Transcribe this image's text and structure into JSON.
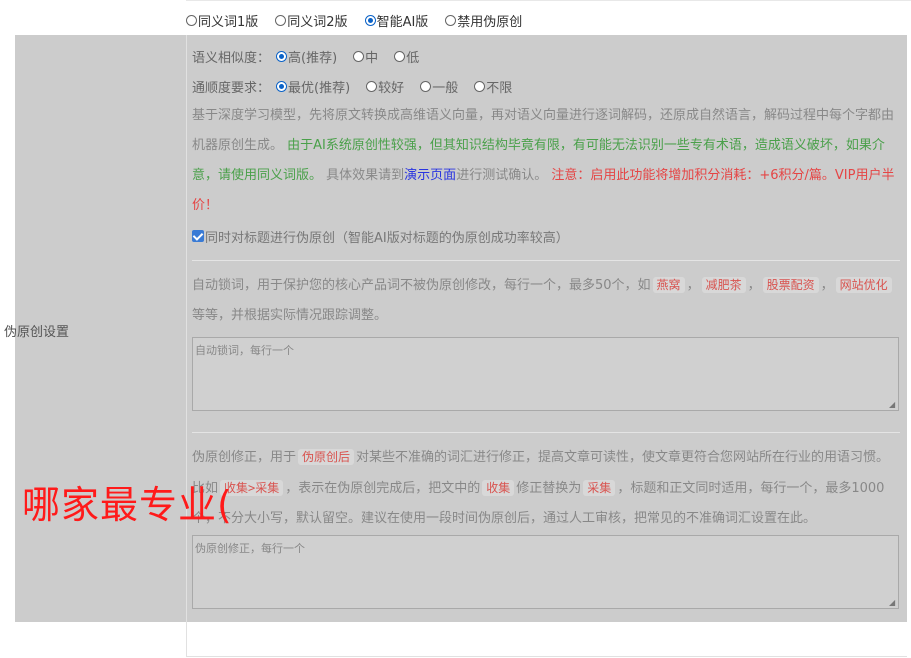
{
  "version_options": [
    {
      "label": "同义词1版",
      "checked": false
    },
    {
      "label": "同义词2版",
      "checked": false
    },
    {
      "label": "智能AI版",
      "checked": true
    },
    {
      "label": "禁用伪原创",
      "checked": false
    }
  ],
  "section_label": "伪原创设置",
  "similarity": {
    "label": "语义相似度：",
    "options": [
      {
        "label": "高(推荐)",
        "checked": true
      },
      {
        "label": "中",
        "checked": false
      },
      {
        "label": "低",
        "checked": false
      }
    ]
  },
  "fluency": {
    "label": "通顺度要求：",
    "options": [
      {
        "label": "最优(推荐)",
        "checked": true
      },
      {
        "label": "较好",
        "checked": false
      },
      {
        "label": "一般",
        "checked": false
      },
      {
        "label": "不限",
        "checked": false
      }
    ]
  },
  "description": {
    "intro": "基于深度学习模型，先将原文转换成高维语义向量，再对语义向量进行逐词解码，还原成自然语言，解码过程中每个字都由机器原创生成。",
    "green_note": "由于AI系统原创性较强，但其知识结构毕竟有限，有可能无法识别一些专有术语，造成语义破坏，如果介意，请使用同义词版。",
    "effect_prefix": "具体效果请到",
    "demo_link": "演示页面",
    "effect_suffix": "进行测试确认。",
    "red_note": "注意：启用此功能将增加积分消耗：+6积分/篇。VIP用户半价！"
  },
  "title_checkbox": {
    "label": "同时对标题进行伪原创（智能AI版对标题的伪原创成功率较高）",
    "checked": true
  },
  "lock_words": {
    "desc_prefix": "自动锁词，用于保护您的核心产品词不被伪原创修改，每行一个，最多50个，如",
    "examples": [
      "燕窝",
      "减肥茶",
      "股票配资",
      "网站优化"
    ],
    "desc_suffix": "等等，并根据实际情况跟踪调整。",
    "placeholder": "自动锁词，每行一个"
  },
  "correction": {
    "p1": "伪原创修正，用于",
    "tag1": "伪原创后",
    "p2": "对某些不准确的词汇进行修正，提高文章可读性，使文章更符合您网站所在行业的用语习惯。比如",
    "tag2": "收集>采集",
    "p3": "，表示在伪原创完成后，把文中的",
    "tag3": "收集",
    "p4": "修正替换为",
    "tag4": "采集",
    "p5": "，标题和正文同时适用，每行一个，最多1000个，不分大小写，默认留空。建议在使用一段时间伪原创后，通过人工审核，把常见的不准确词汇设置在此。",
    "placeholder": "伪原创修正，每行一个"
  },
  "watermark": "哪家最专业(",
  "colors": {
    "accent": "#0b62c7",
    "overlay": "#cccccc",
    "green": "#4aa04a",
    "red": "#e54545",
    "link": "#2a35e0"
  }
}
